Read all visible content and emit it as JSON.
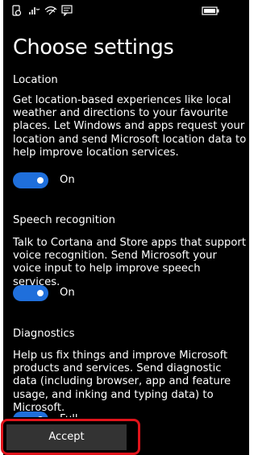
{
  "title": "Choose settings",
  "sections": [
    {
      "heading": "Location",
      "description": "Get location-based experiences like local weather and directions to your favourite places. Let Windows and apps request your location and send Microsoft location data to help improve location services.",
      "toggle": {
        "label": "On",
        "state": true
      }
    },
    {
      "heading": "Speech recognition",
      "description": "Talk to Cortana and Store apps that support voice recognition. Send Microsoft your voice input to help improve speech services.",
      "toggle": {
        "label": "On",
        "state": true
      }
    },
    {
      "heading": "Diagnostics",
      "description": "Help us fix things and improve Microsoft products and services. Send diagnostic data (including browser, app and feature usage, and inking and typing data) to Microsoft.",
      "toggle": {
        "label": "Full",
        "state": true
      }
    }
  ],
  "accept_label": "Accept",
  "colors": {
    "accent": "#1f6fdb",
    "highlight": "#e0141b",
    "background": "#000000"
  },
  "status_icons": [
    "battery-saver-icon",
    "wifi-calling-icon",
    "wifi-icon",
    "message-icon",
    "battery-icon"
  ]
}
